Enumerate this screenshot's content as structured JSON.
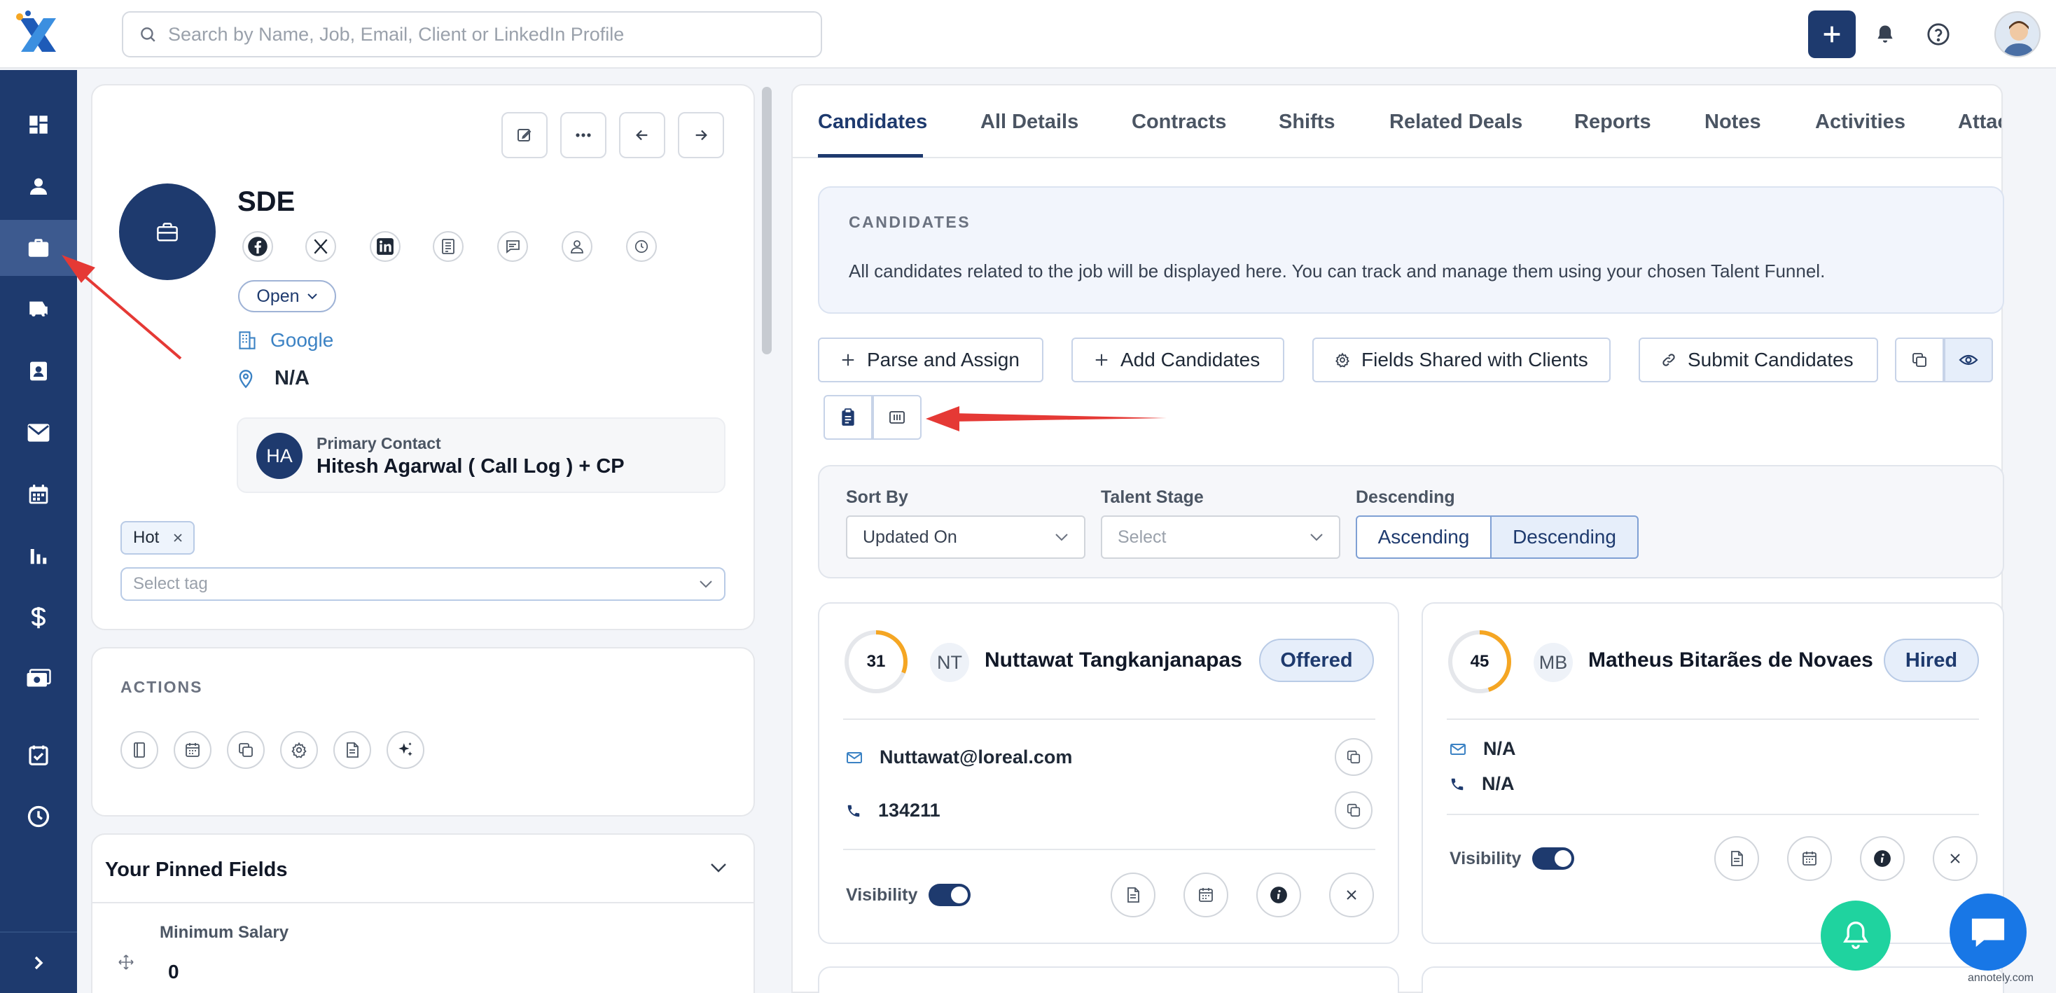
{
  "search": {
    "placeholder": "Search by Name, Job, Email, Client or LinkedIn Profile"
  },
  "job": {
    "title": "SDE",
    "status": "Open",
    "client": "Google",
    "location": "N/A",
    "primary_contact_label": "Primary Contact",
    "primary_contact_initials": "HA",
    "primary_contact_name": "Hitesh Agarwal ( Call Log ) + CP",
    "tags": [
      "Hot"
    ],
    "tag_placeholder": "Select tag"
  },
  "actions": {
    "title": "ACTIONS"
  },
  "pinned": {
    "title": "Your Pinned Fields",
    "field_label": "Minimum Salary",
    "field_value": "0"
  },
  "tabs": [
    "Candidates",
    "All Details",
    "Contracts",
    "Shifts",
    "Related Deals",
    "Reports",
    "Notes",
    "Activities",
    "Attac"
  ],
  "candidates_info": {
    "title": "CANDIDATES",
    "text": "All candidates related to the job will be displayed here. You can track and manage them using your chosen Talent Funnel."
  },
  "buttons": {
    "parse_assign": "Parse and Assign",
    "add_candidates": "Add Candidates",
    "fields_shared": "Fields Shared with Clients",
    "submit_candidates": "Submit Candidates"
  },
  "sort": {
    "sort_by_label": "Sort By",
    "sort_by_value": "Updated On",
    "talent_stage_label": "Talent Stage",
    "talent_stage_placeholder": "Select",
    "order_label": "Descending",
    "ascending": "Ascending",
    "descending": "Descending"
  },
  "candidates": [
    {
      "score": "31",
      "initials": "NT",
      "name": "Nuttawat Tangkanjanapas",
      "stage": "Offered",
      "email": "Nuttawat@loreal.com",
      "phone": "134211",
      "visibility_label": "Visibility",
      "score_value": 31
    },
    {
      "score": "45",
      "initials": "MB",
      "name": "Matheus Bitarães de Novaes",
      "stage": "Hired",
      "email": "N/A",
      "phone": "N/A",
      "visibility_label": "Visibility",
      "score_value": 45
    }
  ],
  "watermark": "annotely.com",
  "colors": {
    "primary": "#1e3a6e",
    "accent_green": "#1fd39f",
    "chat_blue": "#1877e6",
    "score_orange": "#f5a623",
    "annotation_red": "#e53935"
  }
}
